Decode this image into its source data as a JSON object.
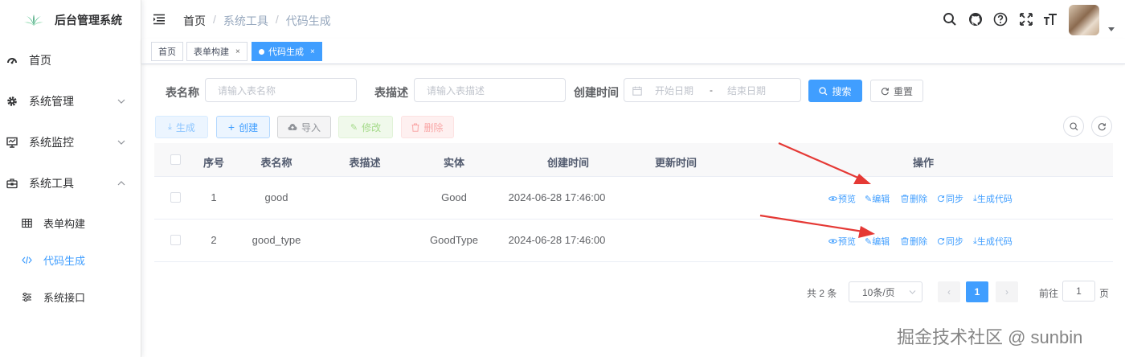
{
  "app": {
    "title": "后台管理系统"
  },
  "sidebar": {
    "items": [
      {
        "label": "首页",
        "icon": "dashboard-icon"
      },
      {
        "label": "系统管理",
        "icon": "gear-icon"
      },
      {
        "label": "系统监控",
        "icon": "monitor-icon"
      },
      {
        "label": "系统工具",
        "icon": "toolbox-icon"
      }
    ],
    "subitems": [
      {
        "label": "表单构建",
        "icon": "table-icon"
      },
      {
        "label": "代码生成",
        "icon": "code-icon",
        "active": true
      },
      {
        "label": "系统接口",
        "icon": "sliders-icon"
      }
    ]
  },
  "header": {
    "breadcrumb": [
      "首页",
      "系统工具",
      "代码生成"
    ],
    "tools": [
      "search-icon",
      "github-icon",
      "help-icon",
      "fullscreen-icon",
      "font-size-icon"
    ]
  },
  "tags": [
    {
      "label": "首页"
    },
    {
      "label": "表单构建",
      "close": "×"
    },
    {
      "label": "代码生成",
      "close": "×",
      "active": true
    }
  ],
  "search": {
    "table_name_label": "表名称",
    "table_name_placeholder": "请输入表名称",
    "table_desc_label": "表描述",
    "table_desc_placeholder": "请输入表描述",
    "create_time_label": "创建时间",
    "start_placeholder": "开始日期",
    "range_sep": "-",
    "end_placeholder": "结束日期",
    "search_button": "搜索",
    "reset_button": "重置"
  },
  "toolbar": {
    "generate": "生成",
    "create": "创建",
    "import": "导入",
    "edit": "修改",
    "delete": "删除"
  },
  "table": {
    "headers": [
      "序号",
      "表名称",
      "表描述",
      "实体",
      "创建时间",
      "更新时间",
      "操作"
    ],
    "rows": [
      {
        "index": "1",
        "name": "good",
        "desc": "",
        "entity": "Good",
        "created": "2024-06-28 17:46:00",
        "updated": ""
      },
      {
        "index": "2",
        "name": "good_type",
        "desc": "",
        "entity": "GoodType",
        "created": "2024-06-28 17:46:00",
        "updated": ""
      }
    ],
    "actions": [
      "预览",
      "编辑",
      "删除",
      "同步",
      "生成代码"
    ]
  },
  "pagination": {
    "total": "共 2 条",
    "page_size": "10条/页",
    "prev": "‹",
    "current": "1",
    "next": "›",
    "goto_label": "前往",
    "goto_value": "1",
    "goto_suffix": "页"
  },
  "watermark": "掘金技术社区 @ sunbin",
  "colors": {
    "primary": "#409eff",
    "annotation_arrow": "#e53935"
  }
}
